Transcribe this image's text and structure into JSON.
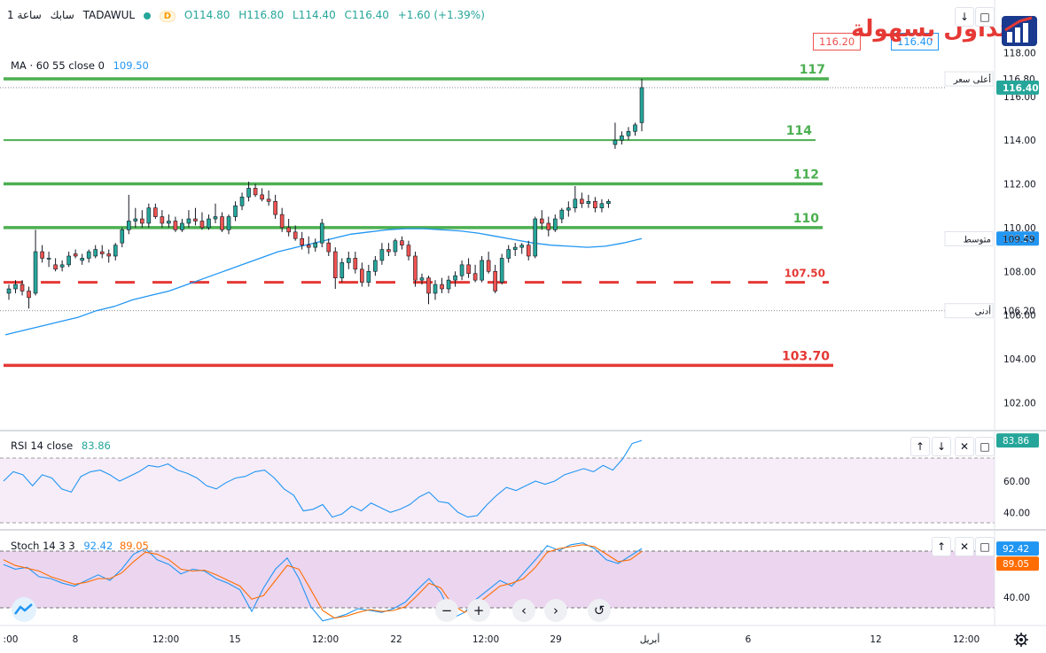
{
  "header": {
    "symbol": "سابك",
    "interval": "ساعة 1",
    "exchange": "TADAWUL",
    "badge": "D",
    "open": "O114.80",
    "high": "H116.80",
    "low": "L114.40",
    "close": "C116.40",
    "change": "+1.60 (+1.39%)"
  },
  "indicators": {
    "ma_label": "MA · 60 55 close 0",
    "ma_value": "109.50",
    "rsi_label": "RSI 14 close",
    "rsi_value": "83.86",
    "stoch_label": "Stoch 14 3 3",
    "stoch_k": "92.42",
    "stoch_d": "89.05"
  },
  "price_boxes": {
    "bid": "116.20",
    "ask": "116.40"
  },
  "brand_text": "التداول بسهولة",
  "colors": {
    "up": "#26a69a",
    "down": "#ef5350",
    "green_line": "#4caf50",
    "red_line": "#e53935",
    "ma": "#2196f3",
    "rsi": "#2196f3",
    "stoch_k": "#2196f3",
    "stoch_d": "#ff6d00",
    "rsi_band": "#f3e5f5",
    "stoch_band": "#e1bee7"
  },
  "toolbar": {
    "zoom_out": "−",
    "zoom_in": "+",
    "prev": "‹",
    "next": "›",
    "reset": "↺",
    "up": "↑",
    "down": "↓",
    "close": "✕",
    "maximize": "□"
  },
  "chart_data": [
    {
      "type": "candlestick",
      "title": "",
      "ylim": [
        100.8,
        119.8
      ],
      "y_ticks": [
        "118.00",
        "116.00",
        "114.00",
        "112.00",
        "110.00",
        "108.00",
        "106.00",
        "104.00",
        "102.00"
      ],
      "x_ticks": [
        ":00",
        "8",
        "12:00",
        "15",
        "12:00",
        "22",
        "12:00",
        "29",
        "أبريل",
        "6",
        "12",
        "12:00"
      ],
      "levels": [
        {
          "value": 116.8,
          "label": "117",
          "color": "green",
          "style": "solid"
        },
        {
          "value": 114.0,
          "label": "114",
          "color": "green",
          "style": "solid"
        },
        {
          "value": 112.0,
          "label": "112",
          "color": "green",
          "style": "solid"
        },
        {
          "value": 110.0,
          "label": "110",
          "color": "green",
          "style": "solid"
        },
        {
          "value": 107.5,
          "label": "107.50",
          "color": "red",
          "style": "dashed"
        },
        {
          "value": 103.7,
          "label": "103.70",
          "color": "red",
          "style": "solid"
        }
      ],
      "axis_labels": [
        {
          "value": 116.8,
          "text": "116.80",
          "tag": "أعلى سعر"
        },
        {
          "value": 116.4,
          "text": "116.40",
          "tag": ""
        },
        {
          "value": 109.5,
          "text": "109.50",
          "tag": "MA"
        },
        {
          "value": 109.49,
          "text": "109.49",
          "tag": "متوسط"
        },
        {
          "value": 106.2,
          "text": "106.20",
          "tag": "أدنى"
        }
      ],
      "candles": [
        [
          107.0,
          107.4,
          106.7,
          107.2
        ],
        [
          107.2,
          107.6,
          107.0,
          107.4
        ],
        [
          107.4,
          107.6,
          106.9,
          107.1
        ],
        [
          107.1,
          107.3,
          106.3,
          106.8
        ],
        [
          107.0,
          109.9,
          106.9,
          108.9
        ],
        [
          108.9,
          109.2,
          108.4,
          108.6
        ],
        [
          108.6,
          108.9,
          108.2,
          108.6
        ],
        [
          108.3,
          108.6,
          108.0,
          108.1
        ],
        [
          108.2,
          108.5,
          108.0,
          108.3
        ],
        [
          108.3,
          108.9,
          108.2,
          108.7
        ],
        [
          108.8,
          109.0,
          108.6,
          108.7
        ],
        [
          108.5,
          108.8,
          108.3,
          108.6
        ],
        [
          108.6,
          109.0,
          108.4,
          108.9
        ],
        [
          108.7,
          109.2,
          108.6,
          109.0
        ],
        [
          108.9,
          109.2,
          108.6,
          108.8
        ],
        [
          108.8,
          109.0,
          108.4,
          108.7
        ],
        [
          108.7,
          109.3,
          108.5,
          109.2
        ],
        [
          109.3,
          110.0,
          109.1,
          109.9
        ],
        [
          109.9,
          111.5,
          109.7,
          110.3
        ],
        [
          110.3,
          110.9,
          110.0,
          110.4
        ],
        [
          110.4,
          110.8,
          110.0,
          110.2
        ],
        [
          110.2,
          111.1,
          110.0,
          110.9
        ],
        [
          110.9,
          111.1,
          110.4,
          110.5
        ],
        [
          110.5,
          110.8,
          110.0,
          110.2
        ],
        [
          110.2,
          110.6,
          110.0,
          110.3
        ],
        [
          110.3,
          110.5,
          109.8,
          109.9
        ],
        [
          109.9,
          110.4,
          109.8,
          110.2
        ],
        [
          110.2,
          110.8,
          110.0,
          110.4
        ],
        [
          110.4,
          110.9,
          110.1,
          110.3
        ],
        [
          110.3,
          110.7,
          109.9,
          110.0
        ],
        [
          110.0,
          110.6,
          109.9,
          110.4
        ],
        [
          110.4,
          111.1,
          110.2,
          110.5
        ],
        [
          110.5,
          110.7,
          109.8,
          109.9
        ],
        [
          109.9,
          110.6,
          109.7,
          110.5
        ],
        [
          110.5,
          111.2,
          110.3,
          111.0
        ],
        [
          111.0,
          111.6,
          110.8,
          111.4
        ],
        [
          111.4,
          112.1,
          111.2,
          111.8
        ],
        [
          111.8,
          112.0,
          111.4,
          111.5
        ],
        [
          111.5,
          111.8,
          111.2,
          111.3
        ],
        [
          111.3,
          111.7,
          111.0,
          111.2
        ],
        [
          111.2,
          111.5,
          110.4,
          110.6
        ],
        [
          110.6,
          110.9,
          109.8,
          110.0
        ],
        [
          110.0,
          110.4,
          109.6,
          109.8
        ],
        [
          109.8,
          110.1,
          109.4,
          109.5
        ],
        [
          109.5,
          109.8,
          109.0,
          109.2
        ],
        [
          109.2,
          109.6,
          108.8,
          109.1
        ],
        [
          109.1,
          109.5,
          108.9,
          109.3
        ],
        [
          109.3,
          110.4,
          109.1,
          110.2
        ],
        [
          109.3,
          109.5,
          108.7,
          108.9
        ],
        [
          108.9,
          109.1,
          107.2,
          107.7
        ],
        [
          107.7,
          108.6,
          107.5,
          108.4
        ],
        [
          108.4,
          108.9,
          108.1,
          108.6
        ],
        [
          108.6,
          108.9,
          107.9,
          108.1
        ],
        [
          108.1,
          108.4,
          107.3,
          107.5
        ],
        [
          107.5,
          108.3,
          107.3,
          108.0
        ],
        [
          108.0,
          108.7,
          107.8,
          108.5
        ],
        [
          108.5,
          109.3,
          108.3,
          109.0
        ],
        [
          109.0,
          109.3,
          108.7,
          108.9
        ],
        [
          108.9,
          109.5,
          108.7,
          109.4
        ],
        [
          109.4,
          109.6,
          109.0,
          109.2
        ],
        [
          109.2,
          109.4,
          108.5,
          108.7
        ],
        [
          108.7,
          108.9,
          107.3,
          107.6
        ],
        [
          107.6,
          107.9,
          107.4,
          107.7
        ],
        [
          107.7,
          107.8,
          106.5,
          107.0
        ],
        [
          107.0,
          107.6,
          106.7,
          107.4
        ],
        [
          107.4,
          107.7,
          107.0,
          107.2
        ],
        [
          107.2,
          107.8,
          107.0,
          107.6
        ],
        [
          107.6,
          108.0,
          107.3,
          107.8
        ],
        [
          107.8,
          108.5,
          107.6,
          108.3
        ],
        [
          108.3,
          108.6,
          107.7,
          107.9
        ],
        [
          107.9,
          108.3,
          107.5,
          107.6
        ],
        [
          107.6,
          108.7,
          107.5,
          108.5
        ],
        [
          108.5,
          108.9,
          107.9,
          108.0
        ],
        [
          108.0,
          108.3,
          107.0,
          107.1
        ],
        [
          107.5,
          108.8,
          107.4,
          108.6
        ],
        [
          108.6,
          109.2,
          108.4,
          109.0
        ],
        [
          109.0,
          109.3,
          108.7,
          109.1
        ],
        [
          109.1,
          109.3,
          108.8,
          109.2
        ],
        [
          109.2,
          109.4,
          108.5,
          108.7
        ],
        [
          108.7,
          110.5,
          108.6,
          110.4
        ],
        [
          110.4,
          110.8,
          109.9,
          110.2
        ],
        [
          110.2,
          110.5,
          109.6,
          109.9
        ],
        [
          109.9,
          110.6,
          109.8,
          110.4
        ],
        [
          110.4,
          110.9,
          110.2,
          110.8
        ],
        [
          110.8,
          111.2,
          110.5,
          110.9
        ],
        [
          110.9,
          111.9,
          110.7,
          111.3
        ],
        [
          111.3,
          111.6,
          110.9,
          111.1
        ],
        [
          111.1,
          111.5,
          110.9,
          111.2
        ],
        [
          111.2,
          111.4,
          110.7,
          110.9
        ],
        [
          110.9,
          111.3,
          110.7,
          111.1
        ],
        [
          111.1,
          111.3,
          110.9,
          111.2
        ],
        [
          113.8,
          114.8,
          113.6,
          114.0
        ],
        [
          114.0,
          114.4,
          113.8,
          114.2
        ],
        [
          114.2,
          114.6,
          114.0,
          114.4
        ],
        [
          114.4,
          114.8,
          114.2,
          114.7
        ],
        [
          114.8,
          116.8,
          114.4,
          116.4
        ]
      ],
      "ma_line": [
        105.1,
        105.3,
        105.5,
        105.7,
        105.9,
        106.2,
        106.4,
        106.7,
        106.9,
        107.1,
        107.4,
        107.7,
        108.0,
        108.3,
        108.6,
        108.9,
        109.1,
        109.3,
        109.5,
        109.7,
        109.8,
        109.9,
        109.95,
        109.95,
        109.9,
        109.85,
        109.75,
        109.6,
        109.45,
        109.3,
        109.2,
        109.15,
        109.1,
        109.15,
        109.3,
        109.5
      ],
      "ma_name": "MA"
    },
    {
      "type": "line",
      "title": "RSI 14 close",
      "ylim": [
        30,
        90
      ],
      "y_ticks": [
        "60.00",
        "40.00"
      ],
      "band": [
        30,
        70
      ],
      "series": [
        {
          "name": "RSI",
          "values": [
            60,
            66,
            64,
            57,
            64,
            62,
            55,
            53,
            63,
            66,
            67,
            64,
            60,
            63,
            66,
            70,
            69,
            71,
            67,
            65,
            62,
            57,
            55,
            59,
            62,
            63,
            66,
            67,
            62,
            55,
            51,
            41,
            42,
            45,
            37,
            39,
            44,
            41,
            46,
            43,
            40,
            42,
            45,
            50,
            53,
            47,
            46,
            40,
            37,
            38,
            45,
            51,
            56,
            54,
            57,
            60,
            58,
            60,
            64,
            66,
            68,
            66,
            70,
            67,
            74,
            84,
            86
          ]
        }
      ]
    },
    {
      "type": "line",
      "title": "Stoch 14 3 3",
      "ylim": [
        10,
        110
      ],
      "y_ticks": [
        "40.00"
      ],
      "band": [
        20,
        80
      ],
      "series": [
        {
          "name": "K",
          "values": [
            75,
            70,
            72,
            62,
            60,
            55,
            52,
            58,
            64,
            58,
            70,
            86,
            92,
            80,
            75,
            65,
            70,
            68,
            60,
            55,
            48,
            25,
            50,
            70,
            82,
            60,
            30,
            15,
            18,
            22,
            28,
            26,
            24,
            28,
            35,
            48,
            60,
            45,
            18,
            24,
            38,
            48,
            58,
            52,
            66,
            80,
            95,
            90,
            96,
            98,
            92,
            80,
            76,
            84,
            92
          ]
        },
        {
          "name": "D",
          "values": [
            80,
            74,
            71,
            68,
            62,
            58,
            54,
            56,
            60,
            60,
            66,
            78,
            88,
            86,
            80,
            70,
            68,
            69,
            64,
            58,
            52,
            38,
            42,
            58,
            74,
            70,
            48,
            26,
            18,
            20,
            24,
            27,
            25,
            26,
            30,
            42,
            55,
            50,
            32,
            24,
            32,
            42,
            52,
            55,
            60,
            72,
            88,
            92,
            94,
            96,
            94,
            86,
            78,
            80,
            89
          ]
        }
      ]
    }
  ]
}
